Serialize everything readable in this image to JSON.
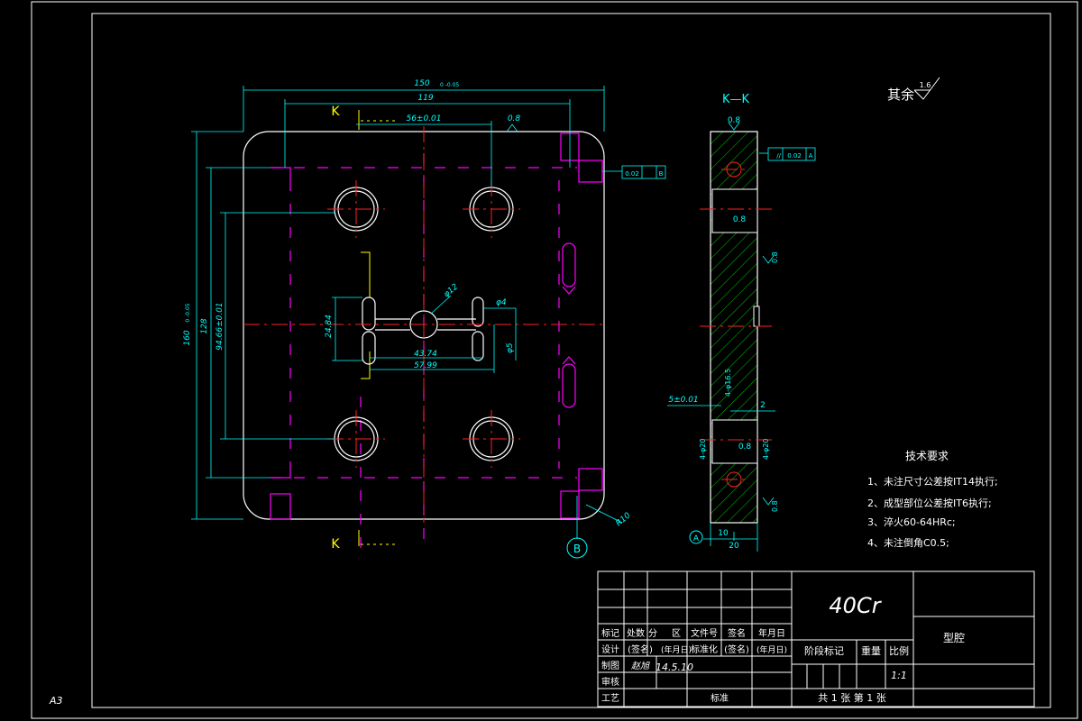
{
  "sheet": {
    "size": "A3"
  },
  "surface_note": {
    "label": "其余",
    "roughness": "1.6"
  },
  "views": {
    "section_label": "K—K",
    "section_mark_top": "K",
    "section_mark_bottom": "K",
    "datum_a": "A",
    "datum_b": "B"
  },
  "dimensions": {
    "width_total": "150",
    "width_tol": "0 -0.05",
    "pitch_119": "119",
    "center_56": "56±0.01",
    "height_total": "160",
    "height_tol": "0 -0.05",
    "pitch_128": "128",
    "center_9466": "94.66±0.01",
    "d_24_84": "24.84",
    "d_43_74": "43.74",
    "d_57_99": "57.99",
    "dia_12": "φ12",
    "dia_4": "φ4",
    "dia_5": "φ5",
    "radius_r10": "R10",
    "rough_08_a": "0.8",
    "rough_08_b": "0.8",
    "rough_08_c": "0.8",
    "rough_08_d": "0.8",
    "rough_08_e": "0.8",
    "rough_08_f": "0.8",
    "perp_tol": "0.02",
    "perp_datum": "B",
    "par_tol": "0.02",
    "par_datum": "A",
    "side_5": "5±0.01",
    "side_2": "2",
    "side_10": "10",
    "side_20": "20",
    "side_dia_a": "4-φ20",
    "side_dia_b": "4-φ20",
    "side_dia_c": "4-φ16.5"
  },
  "tech_requirements": {
    "title": "技术要求",
    "items": [
      "1、未注尺寸公差按IT14执行;",
      "2、成型部位公差按IT6执行;",
      "3、淬火60-64HRc;",
      "4、未注倒角C0.5;"
    ]
  },
  "title_block": {
    "material": "40Cr",
    "part_name": "型腔",
    "header_row": [
      "标记",
      "处数",
      "分",
      "区",
      "文件号",
      "签名",
      "年月日"
    ],
    "row_design": [
      "设计",
      "(签名)",
      "(年月日)",
      "标准化",
      "(签名)",
      "(年月日)"
    ],
    "row_draw": [
      "制图",
      "赵旭",
      "14.5.10"
    ],
    "row_check": "审核",
    "row_process": "工艺",
    "row_approve": "标准",
    "stage_mark": "阶段标记",
    "weight": "重量",
    "scale": "比例",
    "scale_value": "1:1",
    "sheet_count": "共 1 张 第 1 张"
  }
}
